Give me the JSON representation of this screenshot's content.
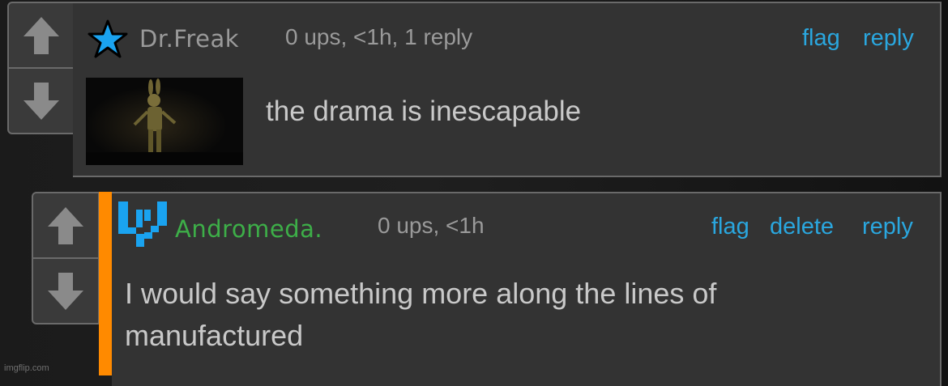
{
  "colors": {
    "link": "#2aa7df",
    "username_1": "#9a9a9a",
    "username_2": "#3dae48",
    "accent_bar": "#ff8a00",
    "meta": "#9a9a9a",
    "body_text": "#c9c9c9"
  },
  "comments": [
    {
      "username": "Dr.Freak",
      "user_icon": "blue-star-icon",
      "meta": "0 ups, <1h, 1 reply",
      "actions": [
        "flag",
        "reply"
      ],
      "image": "dark-stage-figure-thumbnail",
      "text": "the drama is inescapable"
    },
    {
      "username": "Andromeda.",
      "user_icon": "blue-pixel-logo-icon",
      "meta": "0 ups, <1h",
      "actions": [
        "flag",
        "delete",
        "reply"
      ],
      "text_lines": [
        "I would say something more along the lines of",
        "manufactured"
      ]
    }
  ],
  "vote": {
    "up_icon": "upvote-arrow-icon",
    "down_icon": "downvote-arrow-icon"
  },
  "watermark": "imgflip.com"
}
